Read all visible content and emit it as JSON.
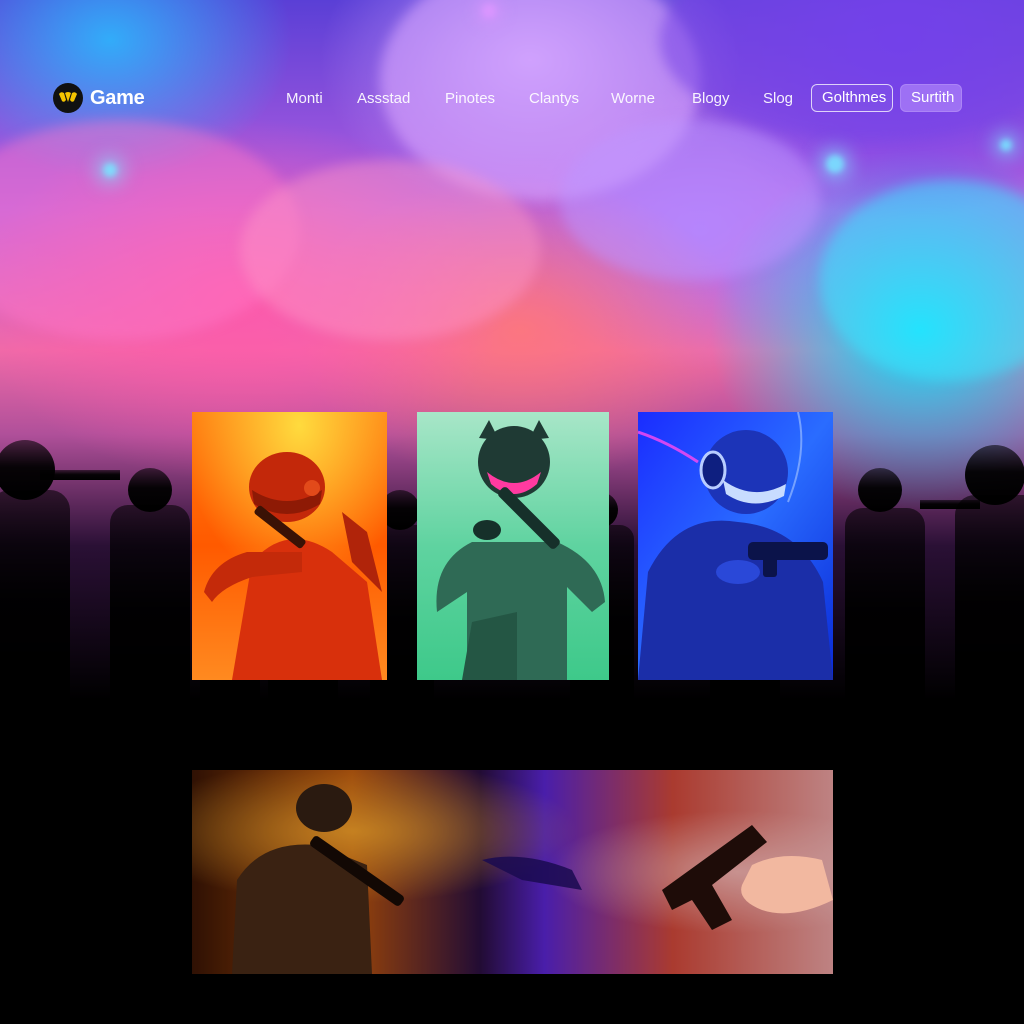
{
  "brand": {
    "name": "Game",
    "logo_icon": "gamepad-logo-icon",
    "accent": "#f5c400"
  },
  "nav": {
    "items": [
      "Monti",
      "Assstad",
      "Pinotes",
      "Clantys",
      "Worne",
      "Blogy",
      "Slog"
    ],
    "outline_button": "Golthmes",
    "filled_button": "Surtith"
  },
  "cards": [
    {
      "theme": "orange-fire",
      "subject": "helmeted soldier aiming rifle",
      "color": "#ff6a1a"
    },
    {
      "theme": "mint-green",
      "subject": "crouching masked soldier with rifle",
      "color": "#4fd49a"
    },
    {
      "theme": "electric-blue",
      "subject": "hooded player with headphones holding pistol",
      "color": "#2a4cff"
    }
  ],
  "banner": {
    "theme": "smoke-gradient",
    "subject": "soldier aiming rifle and hand holding pistol"
  },
  "colors": {
    "sky_cyan": "#00e6ff",
    "sky_pink": "#f06aa8",
    "sky_violet": "#6e3cf0"
  }
}
